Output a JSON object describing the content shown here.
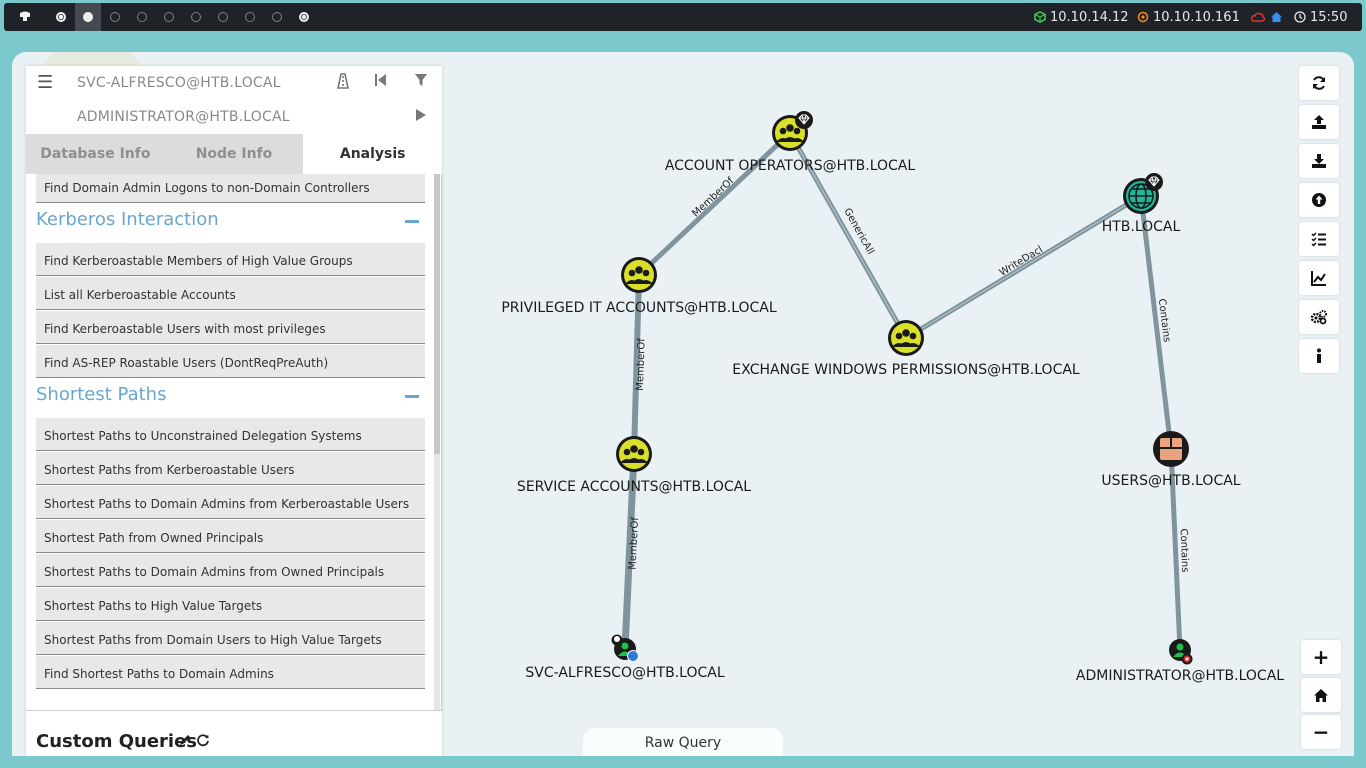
{
  "topbar": {
    "tray": {
      "vpn_ip": "10.10.14.12",
      "target_ip": "10.10.10.161",
      "time": "15:50"
    }
  },
  "search": {
    "start_node": "SVC-ALFRESCO@HTB.LOCAL",
    "end_node": "ADMINISTRATOR@HTB.LOCAL"
  },
  "tabs": [
    "Database Info",
    "Node Info",
    "Analysis"
  ],
  "queries": {
    "top_item": "Find Domain Admin Logons to non-Domain Controllers",
    "kerberos_title": "Kerberos Interaction",
    "kerberos_items": [
      "Find Kerberoastable Members of High Value Groups",
      "List all Kerberoastable Accounts",
      "Find Kerberoastable Users with most privileges",
      "Find AS-REP Roastable Users (DontReqPreAuth)"
    ],
    "shortest_title": "Shortest Paths",
    "shortest_items": [
      "Shortest Paths to Unconstrained Delegation Systems",
      "Shortest Paths from Kerberoastable Users",
      "Shortest Paths to Domain Admins from Kerberoastable Users",
      "Shortest Path from Owned Principals",
      "Shortest Paths to Domain Admins from Owned Principals",
      "Shortest Paths to High Value Targets",
      "Shortest Paths from Domain Users to High Value Targets",
      "Find Shortest Paths to Domain Admins"
    ]
  },
  "custom_queries_title": "Custom Queries",
  "raw_query_label": "Raw Query",
  "zoom": {
    "in": "+",
    "out": "−"
  },
  "graph": {
    "nodes": {
      "account_operators": "ACCOUNT OPERATORS@HTB.LOCAL",
      "privileged_it": "PRIVILEGED IT ACCOUNTS@HTB.LOCAL",
      "service_accounts": "SERVICE ACCOUNTS@HTB.LOCAL",
      "svc_alfresco": "SVC-ALFRESCO@HTB.LOCAL",
      "exchange_windows_permissions": "EXCHANGE WINDOWS PERMISSIONS@HTB.LOCAL",
      "htb_local": "HTB.LOCAL",
      "users": "USERS@HTB.LOCAL",
      "administrator": "ADMINISTRATOR@HTB.LOCAL"
    },
    "edges": {
      "svc_to_service": "MemberOf",
      "service_to_privileged": "MemberOf",
      "privileged_to_account_ops": "MemberOf",
      "account_ops_to_exchange": "GenericAll",
      "exchange_to_htb": "WriteDacl",
      "htb_to_users": "Contains",
      "users_to_admin": "Contains"
    }
  },
  "colors": {
    "group_node": "#d8e02a",
    "domain_node": "#1fb89a",
    "container_node": "#e9a37f",
    "user_node": "#1ec24a",
    "edge": "#7f949d",
    "section_title": "#69a6cf"
  }
}
